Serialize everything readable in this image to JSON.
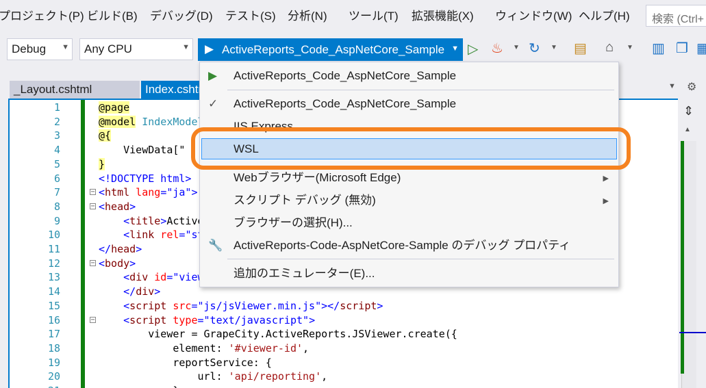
{
  "menubar": {
    "items": [
      "プロジェクト(P)",
      "ビルド(B)",
      "デバッグ(D)",
      "テスト(S)",
      "分析(N)",
      "ツール(T)",
      "拡張機能(X)",
      "ウィンドウ(W)",
      "ヘルプ(H)"
    ],
    "search_placeholder": "検索 (Ctrl+"
  },
  "toolbar": {
    "config": "Debug",
    "platform": "Any CPU",
    "run_target": "ActiveReports_Code_AspNetCore_Sample",
    "icons": [
      "play-outline-icon",
      "hot-reload-icon",
      "refresh-icon",
      "folder-icon",
      "home-icon",
      "layout-icon",
      "windows-icon",
      "grid-icon"
    ]
  },
  "tabs": [
    {
      "label": "_Layout.cshtml",
      "active": false
    },
    {
      "label": "Index.cshtml",
      "active": true
    }
  ],
  "editor": {
    "lines": [
      {
        "n": "1",
        "tokens": [
          {
            "t": "@page",
            "c": "c-raz"
          }
        ]
      },
      {
        "n": "2",
        "tokens": [
          {
            "t": "@model",
            "c": "c-raz"
          },
          {
            "t": " IndexModel",
            "c": "c-type"
          }
        ]
      },
      {
        "n": "3",
        "tokens": [
          {
            "t": "@{",
            "c": "c-raz"
          }
        ]
      },
      {
        "n": "4",
        "tokens": [
          {
            "t": "    ViewData[\"",
            "c": "c-js"
          }
        ]
      },
      {
        "n": "5",
        "tokens": [
          {
            "t": "}",
            "c": "c-raz"
          }
        ]
      },
      {
        "n": "6",
        "tokens": [
          {
            "t": "<!DOCTYPE html>",
            "c": "c-punc"
          }
        ]
      },
      {
        "n": "7",
        "fold": "−",
        "tokens": [
          {
            "t": "<",
            "c": "c-punc"
          },
          {
            "t": "html",
            "c": "c-tag"
          },
          {
            "t": " lang",
            "c": "c-attr"
          },
          {
            "t": "=",
            "c": "c-punc"
          },
          {
            "t": "\"ja\"",
            "c": "c-str"
          },
          {
            "t": ">",
            "c": "c-punc"
          }
        ]
      },
      {
        "n": "8",
        "fold": "−",
        "tokens": [
          {
            "t": "<",
            "c": "c-punc"
          },
          {
            "t": "head",
            "c": "c-tag"
          },
          {
            "t": ">",
            "c": "c-punc"
          }
        ]
      },
      {
        "n": "9",
        "tokens": [
          {
            "t": "    <",
            "c": "c-punc"
          },
          {
            "t": "title",
            "c": "c-tag"
          },
          {
            "t": ">",
            "c": "c-punc"
          },
          {
            "t": "ActiveReports",
            "c": "c-js"
          }
        ]
      },
      {
        "n": "10",
        "tokens": [
          {
            "t": "    <",
            "c": "c-punc"
          },
          {
            "t": "link",
            "c": "c-tag"
          },
          {
            "t": " rel",
            "c": "c-attr"
          },
          {
            "t": "=",
            "c": "c-punc"
          },
          {
            "t": "\"stylesheet\"",
            "c": "c-str"
          }
        ]
      },
      {
        "n": "11",
        "tokens": [
          {
            "t": "</",
            "c": "c-punc"
          },
          {
            "t": "head",
            "c": "c-tag"
          },
          {
            "t": ">",
            "c": "c-punc"
          }
        ]
      },
      {
        "n": "12",
        "fold": "−",
        "tokens": [
          {
            "t": "<",
            "c": "c-punc"
          },
          {
            "t": "body",
            "c": "c-tag"
          },
          {
            "t": ">",
            "c": "c-punc"
          }
        ]
      },
      {
        "n": "13",
        "tokens": [
          {
            "t": "    <",
            "c": "c-punc"
          },
          {
            "t": "div",
            "c": "c-tag"
          },
          {
            "t": " id",
            "c": "c-attr"
          },
          {
            "t": "=",
            "c": "c-punc"
          },
          {
            "t": "\"viewer-id\"",
            "c": "c-str"
          }
        ]
      },
      {
        "n": "14",
        "tokens": [
          {
            "t": "    </",
            "c": "c-punc"
          },
          {
            "t": "div",
            "c": "c-tag"
          },
          {
            "t": ">",
            "c": "c-punc"
          }
        ]
      },
      {
        "n": "15",
        "tokens": [
          {
            "t": "    <",
            "c": "c-punc"
          },
          {
            "t": "script",
            "c": "c-tag"
          },
          {
            "t": " src",
            "c": "c-attr"
          },
          {
            "t": "=",
            "c": "c-punc"
          },
          {
            "t": "\"js/jsViewer.min.js\"",
            "c": "c-str"
          },
          {
            "t": "></",
            "c": "c-punc"
          },
          {
            "t": "script",
            "c": "c-tag"
          },
          {
            "t": ">",
            "c": "c-punc"
          }
        ]
      },
      {
        "n": "16",
        "fold": "−",
        "tokens": [
          {
            "t": "    <",
            "c": "c-punc"
          },
          {
            "t": "script",
            "c": "c-tag"
          },
          {
            "t": " type",
            "c": "c-attr"
          },
          {
            "t": "=",
            "c": "c-punc"
          },
          {
            "t": "\"text/javascript\"",
            "c": "c-str"
          },
          {
            "t": ">",
            "c": "c-punc"
          }
        ]
      },
      {
        "n": "17",
        "tokens": [
          {
            "t": "        viewer = GrapeCity.ActiveReports.JSViewer.create({",
            "c": "c-js"
          }
        ]
      },
      {
        "n": "18",
        "tokens": [
          {
            "t": "            element: ",
            "c": "c-js"
          },
          {
            "t": "'#viewer-id'",
            "c": "c-jsstr"
          },
          {
            "t": ",",
            "c": "c-js"
          }
        ]
      },
      {
        "n": "19",
        "tokens": [
          {
            "t": "            reportService: {",
            "c": "c-js"
          }
        ]
      },
      {
        "n": "20",
        "tokens": [
          {
            "t": "                url: ",
            "c": "c-js"
          },
          {
            "t": "'api/reporting'",
            "c": "c-jsstr"
          },
          {
            "t": ",",
            "c": "c-js"
          }
        ]
      },
      {
        "n": "21",
        "tokens": [
          {
            "t": "            }",
            "c": "c-js"
          }
        ]
      }
    ]
  },
  "dropdown": {
    "items": [
      {
        "label": "ActiveReports_Code_AspNetCore_Sample",
        "icon": "play-icon"
      },
      {
        "label": "ActiveReports_Code_AspNetCore_Sample",
        "icon": "check-icon"
      },
      {
        "label": "IIS Express"
      },
      {
        "label": "WSL",
        "selected": true
      },
      {
        "label": "Webブラウザー(Microsoft Edge)",
        "submenu": true
      },
      {
        "label": "スクリプト デバッグ (無効)",
        "submenu": true
      },
      {
        "label": "ブラウザーの選択(H)..."
      },
      {
        "label": "ActiveReports-Code-AspNetCore-Sample のデバッグ プロパティ",
        "icon": "wrench-icon"
      },
      {
        "label": "追加のエミュレーター(E)..."
      }
    ]
  },
  "colors": {
    "accent": "#007acc",
    "highlight": "#f58220",
    "selection": "#c9def5"
  }
}
